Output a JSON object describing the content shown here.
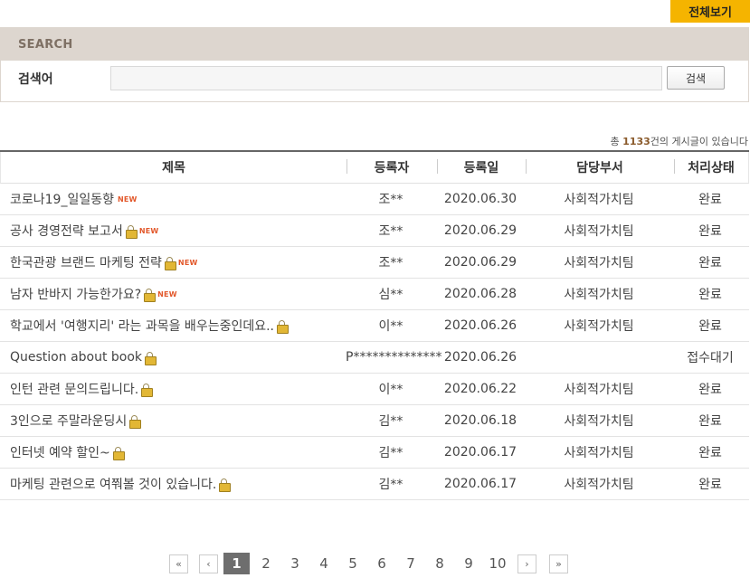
{
  "view_all_label": "전체보기",
  "search": {
    "heading": "SEARCH",
    "label": "검색어",
    "value": "",
    "button_label": "검색"
  },
  "total": {
    "prefix": "총 ",
    "count": "1133",
    "suffix": "건의 게시글이 있습니다"
  },
  "columns": {
    "title": "제목",
    "author": "등록자",
    "date": "등록일",
    "dept": "담당부서",
    "status": "처리상태"
  },
  "rows": [
    {
      "title": "코로나19_일일동향",
      "locked": false,
      "is_new": true,
      "author": "조**",
      "date": "2020.06.30",
      "dept": "사회적가치팀",
      "status": "완료"
    },
    {
      "title": "공사 경영전략 보고서",
      "locked": true,
      "is_new": true,
      "author": "조**",
      "date": "2020.06.29",
      "dept": "사회적가치팀",
      "status": "완료"
    },
    {
      "title": "한국관광 브랜드 마케팅 전략",
      "locked": true,
      "is_new": true,
      "author": "조**",
      "date": "2020.06.29",
      "dept": "사회적가치팀",
      "status": "완료"
    },
    {
      "title": "남자 반바지 가능한가요?",
      "locked": true,
      "is_new": true,
      "author": "심**",
      "date": "2020.06.28",
      "dept": "사회적가치팀",
      "status": "완료"
    },
    {
      "title": "학교에서 '여행지리' 라는 과목을 배우는중인데요..",
      "locked": true,
      "is_new": false,
      "author": "이**",
      "date": "2020.06.26",
      "dept": "사회적가치팀",
      "status": "완료"
    },
    {
      "title": "Question about book",
      "locked": true,
      "is_new": false,
      "author": "P**************",
      "date": "2020.06.26",
      "dept": "",
      "status": "접수대기"
    },
    {
      "title": "인턴 관련 문의드립니다.",
      "locked": true,
      "is_new": false,
      "author": "이**",
      "date": "2020.06.22",
      "dept": "사회적가치팀",
      "status": "완료"
    },
    {
      "title": "3인으로 주말라운딩시",
      "locked": true,
      "is_new": false,
      "author": "김**",
      "date": "2020.06.18",
      "dept": "사회적가치팀",
      "status": "완료"
    },
    {
      "title": "인터넷 예약 할인~",
      "locked": true,
      "is_new": false,
      "author": "김**",
      "date": "2020.06.17",
      "dept": "사회적가치팀",
      "status": "완료"
    },
    {
      "title": "마케팅 관련으로 여쭤볼 것이 있습니다.",
      "locked": true,
      "is_new": false,
      "author": "김**",
      "date": "2020.06.17",
      "dept": "사회적가치팀",
      "status": "완료"
    }
  ],
  "new_badge": "NEW",
  "pagination": {
    "first": "«",
    "prev": "‹",
    "pages": [
      "1",
      "2",
      "3",
      "4",
      "5",
      "6",
      "7",
      "8",
      "9",
      "10"
    ],
    "current": "1",
    "next": "›",
    "last": "»"
  }
}
